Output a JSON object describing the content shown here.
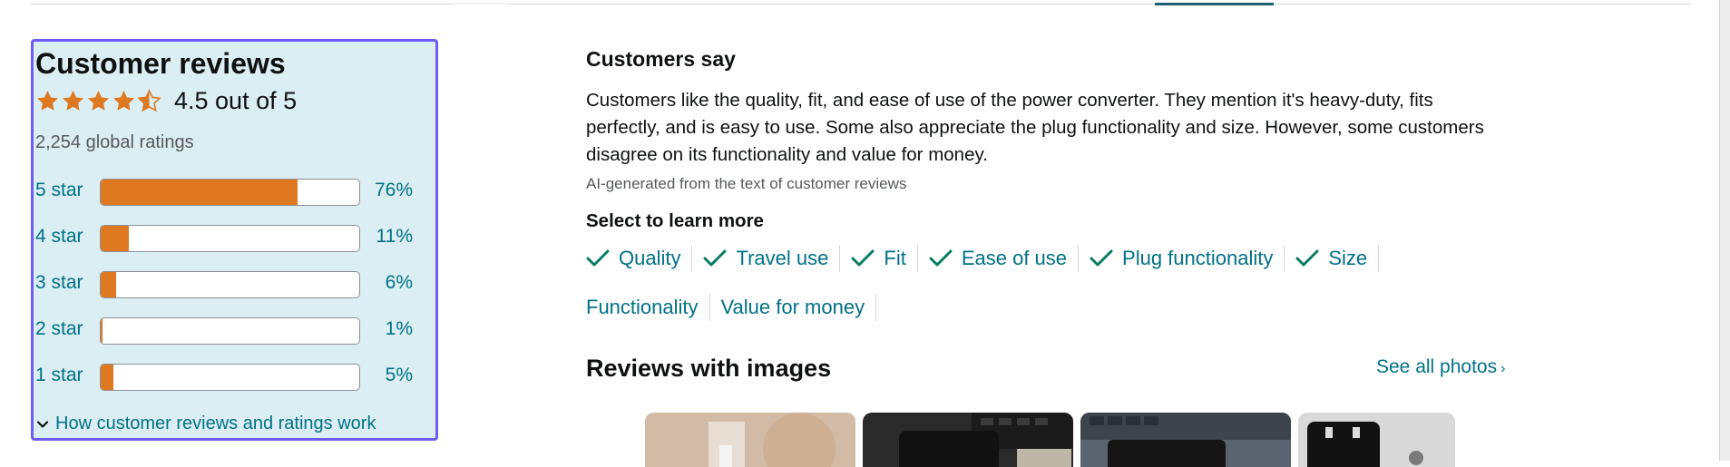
{
  "reviews": {
    "title": "Customer reviews",
    "rating_value": 4.5,
    "rating_text": "4.5 out of 5",
    "global_ratings": "2,254 global ratings",
    "histogram": [
      {
        "label": "5 star",
        "percent_text": "76%",
        "percent": 76
      },
      {
        "label": "4 star",
        "percent_text": "11%",
        "percent": 11
      },
      {
        "label": "3 star",
        "percent_text": "6%",
        "percent": 6
      },
      {
        "label": "2 star",
        "percent_text": "1%",
        "percent": 1
      },
      {
        "label": "1 star",
        "percent_text": "5%",
        "percent": 5
      }
    ],
    "how_link": "How customer reviews and ratings work"
  },
  "summary": {
    "heading": "Customers say",
    "text": "Customers like the quality, fit, and ease of use of the power converter. They mention it's heavy-duty, fits perfectly, and is easy to use. Some also appreciate the plug functionality and size. However, some customers disagree on its functionality and value for money.",
    "ai_note": "AI-generated from the text of customer reviews",
    "select_heading": "Select to learn more",
    "aspects": [
      {
        "label": "Quality",
        "positive": true
      },
      {
        "label": "Travel use",
        "positive": true
      },
      {
        "label": "Fit",
        "positive": true
      },
      {
        "label": "Ease of use",
        "positive": true
      },
      {
        "label": "Plug functionality",
        "positive": true
      },
      {
        "label": "Size",
        "positive": true
      },
      {
        "label": "Functionality",
        "positive": false
      },
      {
        "label": "Value for money",
        "positive": false
      }
    ]
  },
  "images_section": {
    "heading": "Reviews with images",
    "see_all": "See all photos",
    "see_all_chevron": "›"
  },
  "colors": {
    "star": "#de7921",
    "link": "#007185",
    "panel_bg": "#dbeef4",
    "panel_border": "#6b5cf5",
    "check": "#067d62"
  }
}
